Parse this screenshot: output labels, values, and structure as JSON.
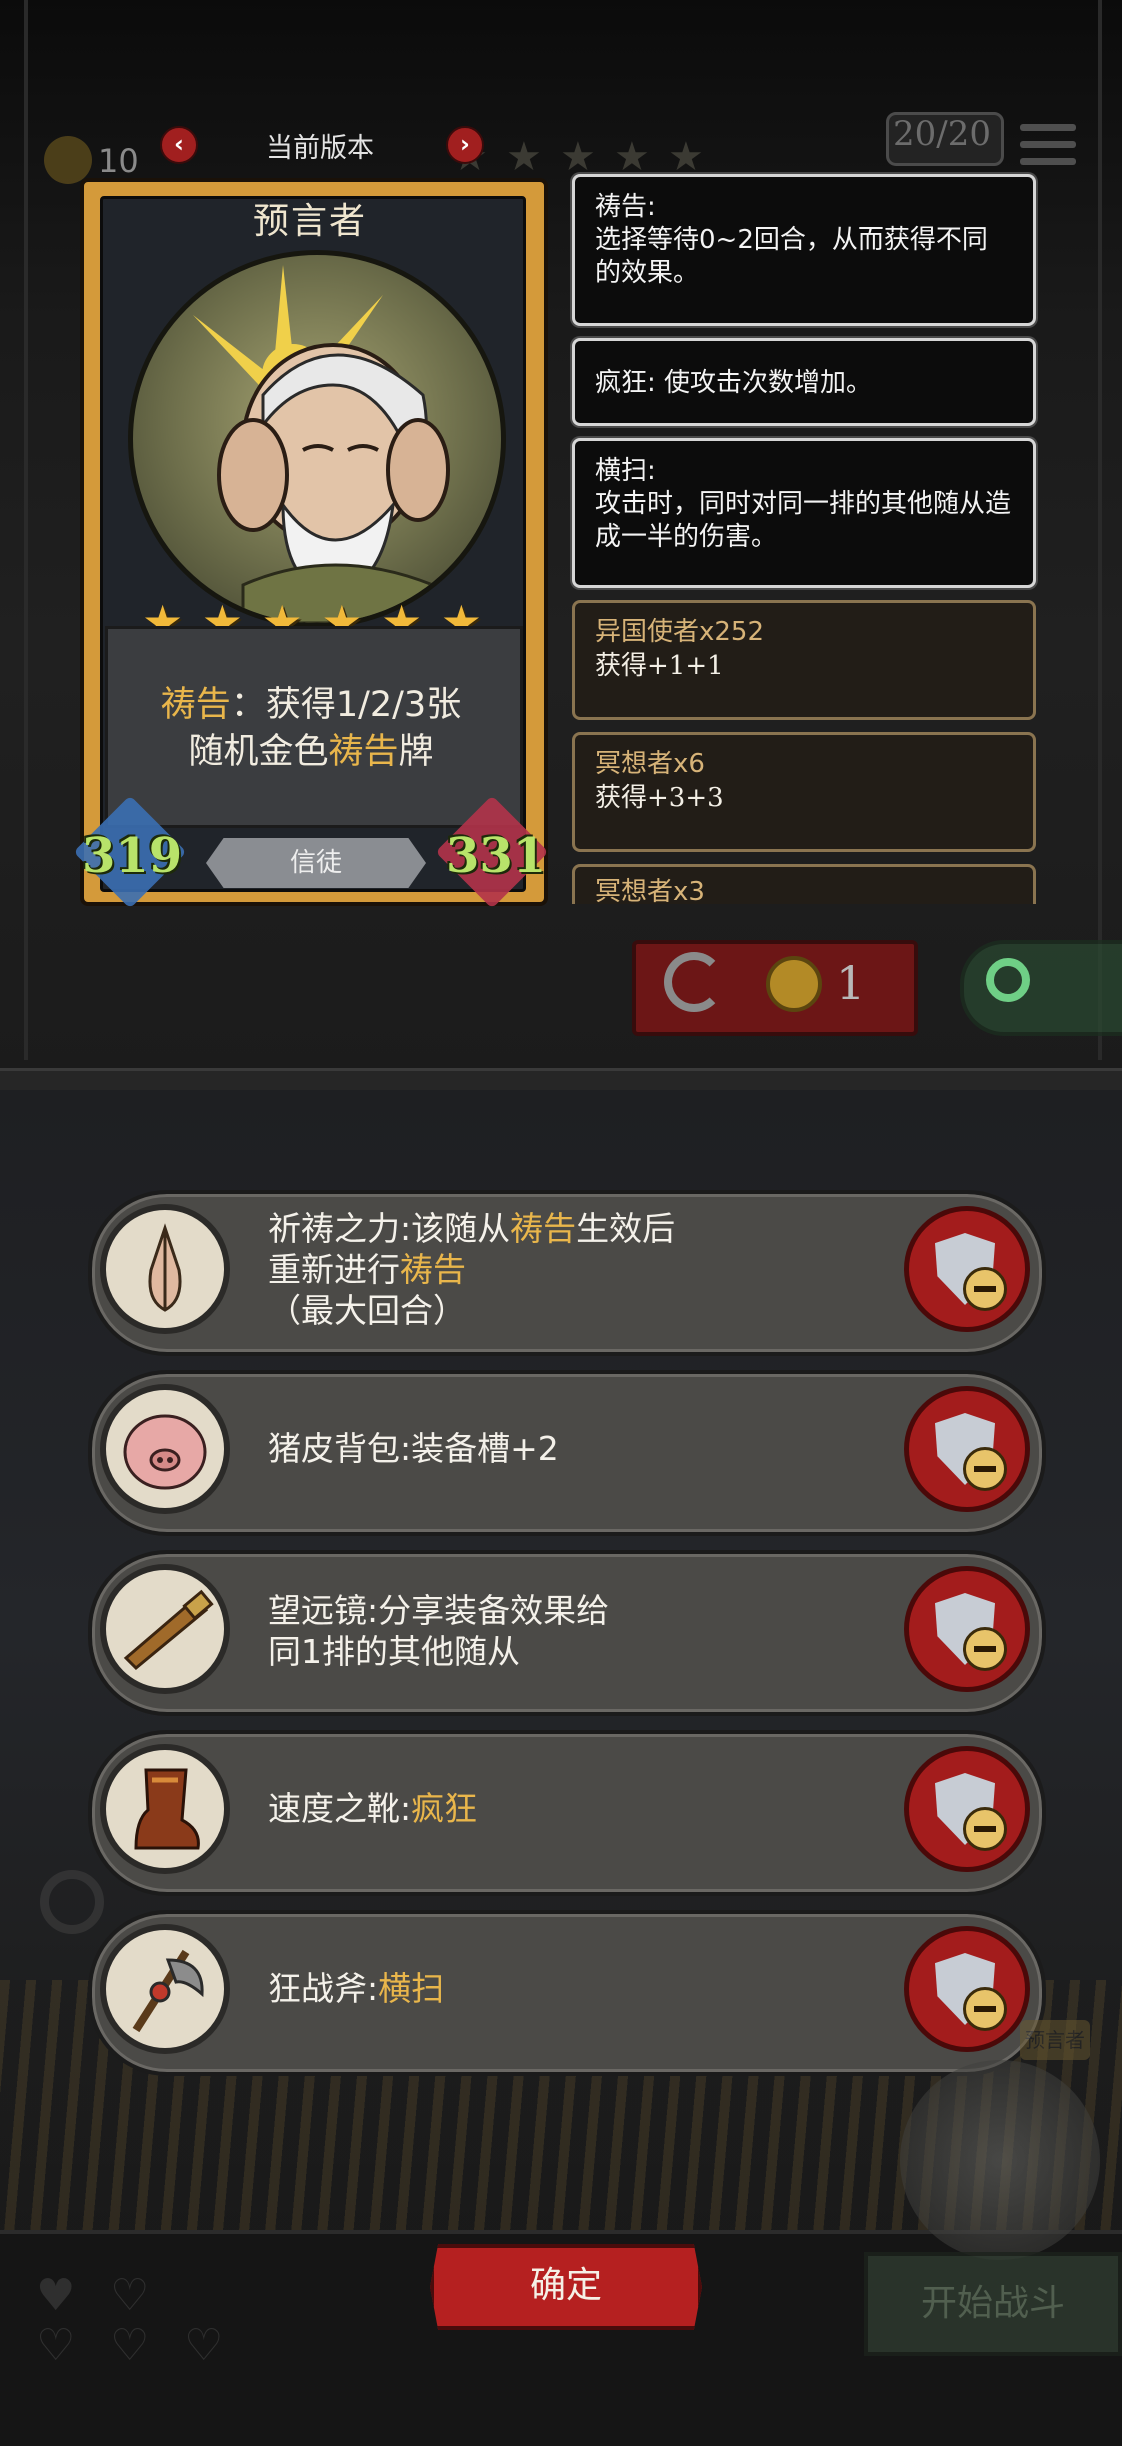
{
  "hud": {
    "coins": "10",
    "counter": "20/20"
  },
  "version": {
    "title": "当前版本",
    "prev": "‹",
    "next": "›"
  },
  "card": {
    "name": "预言者",
    "stars": 6,
    "desc_parts": [
      "祷告",
      "：获得1/2/3张",
      "随机金色",
      "祷告",
      "牌"
    ],
    "attack": "319",
    "health": "331",
    "tribe": "信徒"
  },
  "abilities": [
    {
      "title": "祷告:",
      "body": "选择等待0~2回合，从而获得不同的效果。"
    },
    {
      "title": "",
      "body": "疯狂: 使攻击次数增加。"
    },
    {
      "title": "横扫:",
      "body": "攻击时，同时对同一排的其他随从造成一半的伤害。"
    }
  ],
  "synergies": [
    {
      "name": "异国使者x252",
      "value": "获得+1+1"
    },
    {
      "name": "冥想者x6",
      "value": "获得+3+3"
    },
    {
      "name": "冥想者x3",
      "value": ""
    }
  ],
  "refresh": {
    "cost": "1"
  },
  "equipment": [
    {
      "icon": "praying-hands-icon",
      "parts": [
        "祈祷之力:该随从",
        "祷告",
        "生效后",
        "重新进行",
        "祷告",
        "（最大回合）"
      ]
    },
    {
      "icon": "pig-backpack-icon",
      "parts": [
        "猪皮背包:装备槽+2"
      ]
    },
    {
      "icon": "telescope-icon",
      "parts": [
        "望远镜:分享装备效果给",
        "同1排的其他随从"
      ]
    },
    {
      "icon": "speed-boots-icon",
      "parts": [
        "速度之靴:",
        "疯狂"
      ]
    },
    {
      "icon": "berserker-axe-icon",
      "parts": [
        "狂战斧:",
        "横扫"
      ]
    }
  ],
  "buttons": {
    "confirm": "确定",
    "start_battle": "开始战斗",
    "tag": "预言者"
  },
  "colors": {
    "gold_text": "#e9b64b",
    "star": "#f1b93a",
    "stat_green": "#b8e36a",
    "remove_button": "#a31c1c"
  }
}
